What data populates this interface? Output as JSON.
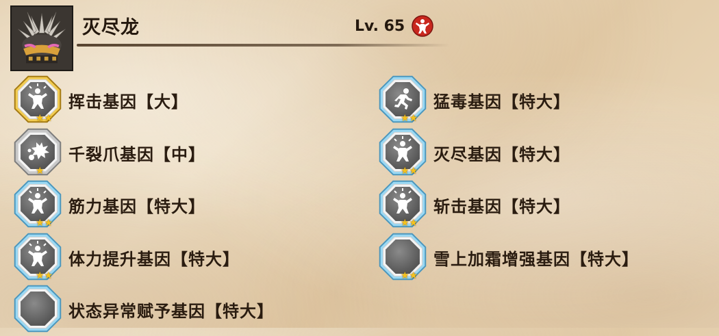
{
  "monster": {
    "name": "灭尽龙",
    "level_text": "Lv. 65",
    "level_badge_icon": "strength-emblem-icon"
  },
  "genes_left": [
    {
      "name": "挥击基因【大】",
      "frame": "gold",
      "symbol": "strength-figure-icon",
      "stars": "★★"
    },
    {
      "name": "千裂爪基因【中】",
      "frame": "silver",
      "symbol": "burst-icon",
      "stars": "★"
    },
    {
      "name": "筋力基因【特大】",
      "frame": "blue",
      "symbol": "strength-figure-icon",
      "stars": "★★"
    },
    {
      "name": "体力提升基因【特大】",
      "frame": "blue",
      "symbol": "strength-figure-icon",
      "stars": "★★"
    },
    {
      "name": "状态异常赋予基因【特大】",
      "frame": "blue",
      "symbol": "blank-icon",
      "stars": ""
    }
  ],
  "genes_right": [
    {
      "name": "猛毒基因【特大】",
      "frame": "blue",
      "symbol": "running-figure-icon",
      "stars": "★★"
    },
    {
      "name": "灭尽基因【特大】",
      "frame": "blue",
      "symbol": "strength-figure-icon",
      "stars": "★★"
    },
    {
      "name": "斩击基因【特大】",
      "frame": "blue",
      "symbol": "strength-figure-icon",
      "stars": "★★"
    },
    {
      "name": "雪上加霜增强基因【特大】",
      "frame": "blue",
      "symbol": "blank-icon",
      "stars": "★★"
    }
  ],
  "colors": {
    "gold_frame": "#e2b53a",
    "silver_frame": "#b9b9b9",
    "blue_frame": "#8fd0ef",
    "star": "#f6c21c",
    "badge_red": "#c8271e"
  }
}
